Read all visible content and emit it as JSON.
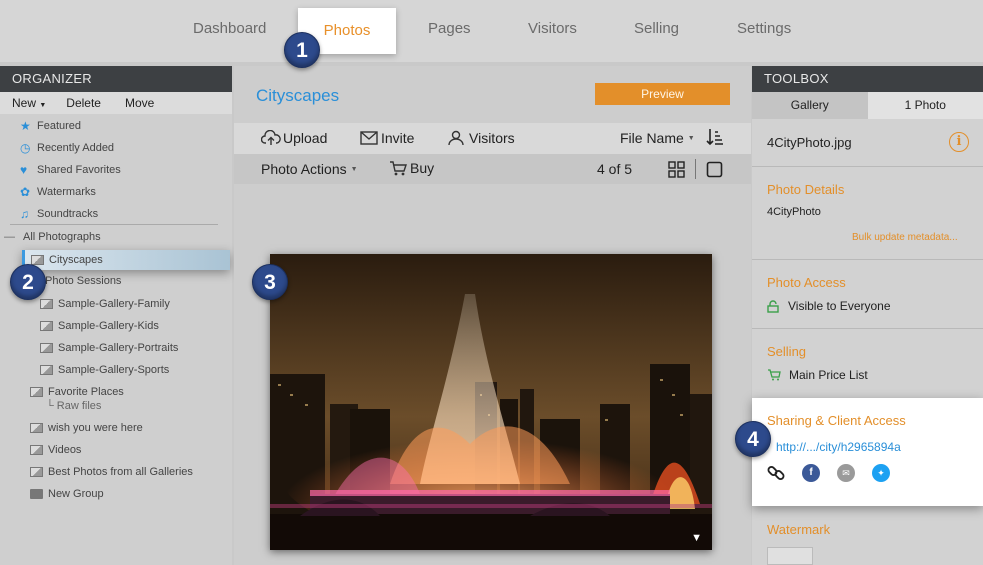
{
  "topnav": {
    "tabs": [
      "Dashboard",
      "Photos",
      "Pages",
      "Visitors",
      "Selling",
      "Settings"
    ]
  },
  "organizer": {
    "header": "ORGANIZER",
    "toolbar": {
      "new": "New",
      "delete": "Delete",
      "move": "Move"
    },
    "quick_links": [
      "Featured",
      "Recently Added",
      "Shared Favorites",
      "Watermarks",
      "Soundtracks"
    ],
    "root": "All Photographs",
    "selected": "Cityscapes",
    "items": [
      "Photo Sessions",
      "Sample-Gallery-Family",
      "Sample-Gallery-Kids",
      "Sample-Gallery-Portraits",
      "Sample-Gallery-Sports",
      "Favorite Places",
      "Raw files",
      "wish you were here",
      "Videos",
      "Best Photos from all Galleries",
      "New Group"
    ]
  },
  "main": {
    "title": "Cityscapes",
    "preview": "Preview",
    "toolbar": {
      "upload": "Upload",
      "invite": "Invite",
      "visitors": "Visitors",
      "sort": "File Name"
    },
    "actions": {
      "photo_actions": "Photo Actions",
      "buy": "Buy",
      "counter": "4 of 5"
    }
  },
  "toolbox": {
    "header": "TOOLBOX",
    "tabs": [
      "Gallery",
      "1 Photo"
    ],
    "filename": "4CityPhoto.jpg",
    "details": {
      "title": "Photo Details",
      "name": "4CityPhoto",
      "bulk_link": "Bulk update metadata..."
    },
    "access": {
      "title": "Photo Access",
      "value": "Visible to Everyone"
    },
    "selling": {
      "title": "Selling",
      "value": "Main Price List"
    },
    "sharing": {
      "title": "Sharing & Client Access",
      "url": "http://.../city/h2965894a"
    },
    "watermark": {
      "title": "Watermark"
    }
  },
  "badges": [
    "1",
    "2",
    "3",
    "4"
  ],
  "colors": {
    "accent": "#e38f2a",
    "link": "#2a8fd8",
    "badge": "#2d4a8c"
  }
}
